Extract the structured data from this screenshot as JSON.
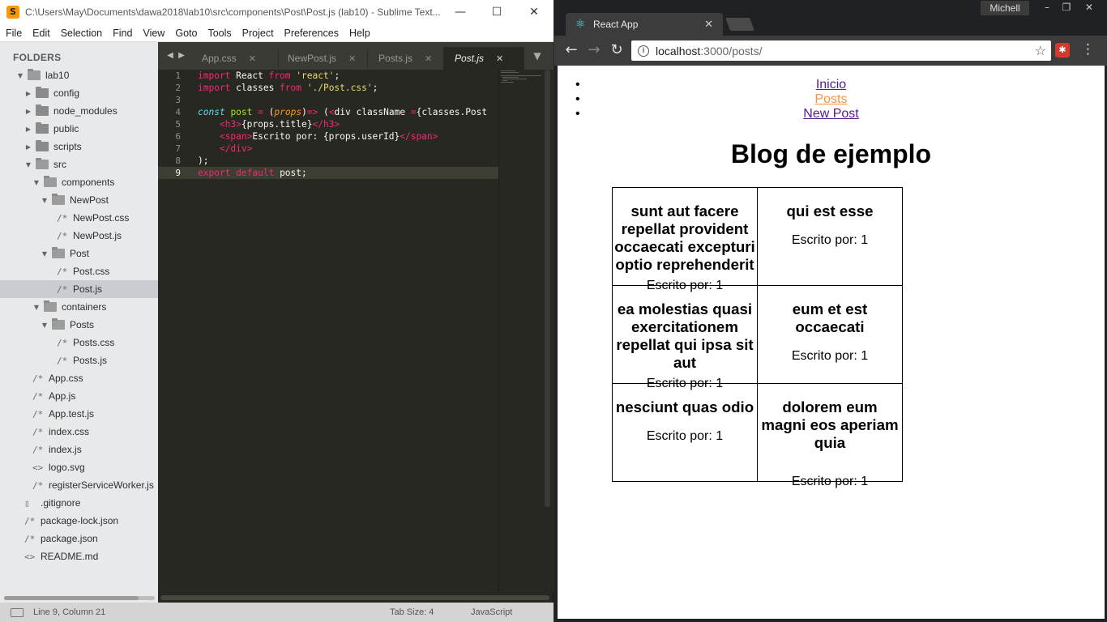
{
  "sublime": {
    "title": "C:\\Users\\May\\Documents\\dawa2018\\lab10\\src\\components\\Post\\Post.js (lab10) - Sublime Text...",
    "menu": [
      "File",
      "Edit",
      "Selection",
      "Find",
      "View",
      "Goto",
      "Tools",
      "Project",
      "Preferences",
      "Help"
    ],
    "folders_header": "FOLDERS",
    "tree": [
      {
        "label": "lab10",
        "type": "folder-open"
      },
      {
        "label": "config",
        "type": "folder"
      },
      {
        "label": "node_modules",
        "type": "folder"
      },
      {
        "label": "public",
        "type": "folder"
      },
      {
        "label": "scripts",
        "type": "folder"
      },
      {
        "label": "src",
        "type": "folder-open"
      },
      {
        "label": "components",
        "type": "folder-open"
      },
      {
        "label": "NewPost",
        "type": "folder-open"
      },
      {
        "label": "NewPost.css",
        "type": "file"
      },
      {
        "label": "NewPost.js",
        "type": "file"
      },
      {
        "label": "Post",
        "type": "folder-open"
      },
      {
        "label": "Post.css",
        "type": "file"
      },
      {
        "label": "Post.js",
        "type": "file"
      },
      {
        "label": "containers",
        "type": "folder-open"
      },
      {
        "label": "Posts",
        "type": "folder-open"
      },
      {
        "label": "Posts.css",
        "type": "file"
      },
      {
        "label": "Posts.js",
        "type": "file"
      },
      {
        "label": "App.css",
        "type": "file"
      },
      {
        "label": "App.js",
        "type": "file"
      },
      {
        "label": "App.test.js",
        "type": "file"
      },
      {
        "label": "index.css",
        "type": "file"
      },
      {
        "label": "index.js",
        "type": "file"
      },
      {
        "label": "logo.svg",
        "type": "file-code"
      },
      {
        "label": "registerServiceWorker.js",
        "type": "file"
      },
      {
        "label": ".gitignore",
        "type": "file-plain"
      },
      {
        "label": "package-lock.json",
        "type": "file"
      },
      {
        "label": "package.json",
        "type": "file"
      },
      {
        "label": "README.md",
        "type": "file-code"
      }
    ],
    "tabs": [
      {
        "label": "App.css",
        "close": "✕"
      },
      {
        "label": "NewPost.js",
        "close": "✕"
      },
      {
        "label": "Posts.js",
        "close": "✕"
      },
      {
        "label": "Post.js",
        "close": "✕"
      }
    ],
    "code_line_numbers": [
      "1",
      "2",
      "3",
      "4",
      "5",
      "6",
      "7",
      "8",
      "9"
    ],
    "status": {
      "position": "Line 9, Column 21",
      "tab_size": "Tab Size: 4",
      "syntax": "JavaScript"
    },
    "colors": {
      "editor_bg": "#272822",
      "keyword": "#f92672",
      "string": "#e6db74"
    }
  },
  "chrome": {
    "user": "Michell",
    "tab_title": "React App",
    "url_host": "localhost",
    "url_path": ":3000/posts/",
    "page": {
      "nav": [
        {
          "label": "Inicio",
          "active": false
        },
        {
          "label": "Posts",
          "active": true
        },
        {
          "label": "New Post",
          "active": false
        }
      ],
      "title": "Blog de ejemplo",
      "posts": [
        {
          "title": "sunt aut facere repellat provident occaecati excepturi optio reprehenderit",
          "author": "Escrito por: 1"
        },
        {
          "title": "qui est esse",
          "author": "Escrito por: 1"
        },
        {
          "title": "ea molestias quasi exercitationem repellat qui ipsa sit aut",
          "author": "Escrito por: 1"
        },
        {
          "title": "eum et est occaecati",
          "author": "Escrito por: 1"
        },
        {
          "title": "nesciunt quas odio",
          "author": "Escrito por: 1"
        },
        {
          "title": "dolorem eum magni eos aperiam quia",
          "author": "Escrito por: 1"
        }
      ]
    }
  }
}
